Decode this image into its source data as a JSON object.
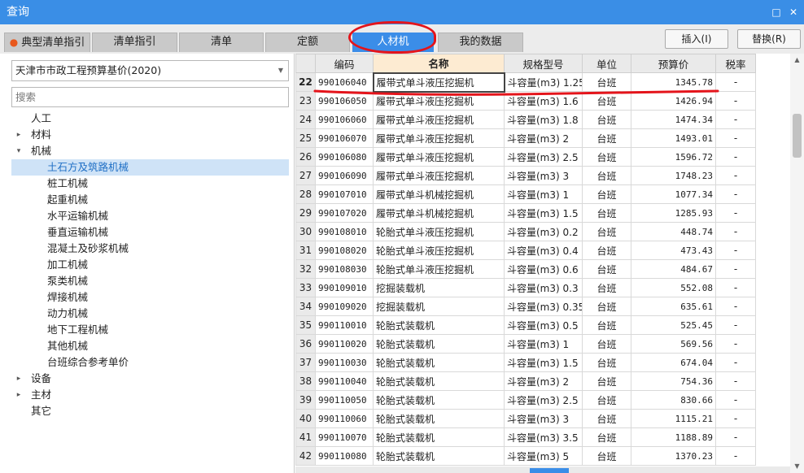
{
  "window": {
    "title": "查询"
  },
  "tabs": [
    {
      "label": "典型清单指引"
    },
    {
      "label": "清单指引"
    },
    {
      "label": "清单"
    },
    {
      "label": "定额"
    },
    {
      "label": "人材机"
    },
    {
      "label": "我的数据"
    }
  ],
  "actions": {
    "insert_label": "插入(I)",
    "replace_label": "替换(R)"
  },
  "left": {
    "library_selected": "天津市市政工程预算基价(2020)",
    "search_placeholder": "搜索",
    "tree": [
      {
        "label": "人工",
        "expander": ""
      },
      {
        "label": "材料",
        "expander": "▸"
      },
      {
        "label": "机械",
        "expander": "▾"
      },
      {
        "label": "土石方及筑路机械",
        "expander": ""
      },
      {
        "label": "桩工机械",
        "expander": ""
      },
      {
        "label": "起重机械",
        "expander": ""
      },
      {
        "label": "水平运输机械",
        "expander": ""
      },
      {
        "label": "垂直运输机械",
        "expander": ""
      },
      {
        "label": "混凝土及砂浆机械",
        "expander": ""
      },
      {
        "label": "加工机械",
        "expander": ""
      },
      {
        "label": "泵类机械",
        "expander": ""
      },
      {
        "label": "焊接机械",
        "expander": ""
      },
      {
        "label": "动力机械",
        "expander": ""
      },
      {
        "label": "地下工程机械",
        "expander": ""
      },
      {
        "label": "其他机械",
        "expander": ""
      },
      {
        "label": "台班综合参考单价",
        "expander": ""
      },
      {
        "label": "设备",
        "expander": "▸"
      },
      {
        "label": "主材",
        "expander": "▸"
      },
      {
        "label": "其它",
        "expander": ""
      }
    ]
  },
  "grid": {
    "headers": {
      "code": "编码",
      "name": "名称",
      "spec": "规格型号",
      "unit": "单位",
      "price": "预算价",
      "tax": "税率"
    },
    "rows": [
      {
        "n": "22",
        "code": "990106040",
        "name": "履带式单斗液压挖掘机",
        "spec": "斗容量(m3) 1.25",
        "unit": "台班",
        "price": "1345.78",
        "tax": "-"
      },
      {
        "n": "23",
        "code": "990106050",
        "name": "履带式单斗液压挖掘机",
        "spec": "斗容量(m3) 1.6",
        "unit": "台班",
        "price": "1426.94",
        "tax": "-"
      },
      {
        "n": "24",
        "code": "990106060",
        "name": "履带式单斗液压挖掘机",
        "spec": "斗容量(m3) 1.8",
        "unit": "台班",
        "price": "1474.34",
        "tax": "-"
      },
      {
        "n": "25",
        "code": "990106070",
        "name": "履带式单斗液压挖掘机",
        "spec": "斗容量(m3) 2",
        "unit": "台班",
        "price": "1493.01",
        "tax": "-"
      },
      {
        "n": "26",
        "code": "990106080",
        "name": "履带式单斗液压挖掘机",
        "spec": "斗容量(m3) 2.5",
        "unit": "台班",
        "price": "1596.72",
        "tax": "-"
      },
      {
        "n": "27",
        "code": "990106090",
        "name": "履带式单斗液压挖掘机",
        "spec": "斗容量(m3) 3",
        "unit": "台班",
        "price": "1748.23",
        "tax": "-"
      },
      {
        "n": "28",
        "code": "990107010",
        "name": "履带式单斗机械挖掘机",
        "spec": "斗容量(m3) 1",
        "unit": "台班",
        "price": "1077.34",
        "tax": "-"
      },
      {
        "n": "29",
        "code": "990107020",
        "name": "履带式单斗机械挖掘机",
        "spec": "斗容量(m3) 1.5",
        "unit": "台班",
        "price": "1285.93",
        "tax": "-"
      },
      {
        "n": "30",
        "code": "990108010",
        "name": "轮胎式单斗液压挖掘机",
        "spec": "斗容量(m3) 0.2",
        "unit": "台班",
        "price": "448.74",
        "tax": "-"
      },
      {
        "n": "31",
        "code": "990108020",
        "name": "轮胎式单斗液压挖掘机",
        "spec": "斗容量(m3) 0.4",
        "unit": "台班",
        "price": "473.43",
        "tax": "-"
      },
      {
        "n": "32",
        "code": "990108030",
        "name": "轮胎式单斗液压挖掘机",
        "spec": "斗容量(m3) 0.6",
        "unit": "台班",
        "price": "484.67",
        "tax": "-"
      },
      {
        "n": "33",
        "code": "990109010",
        "name": "挖掘装载机",
        "spec": "斗容量(m3) 0.3",
        "unit": "台班",
        "price": "552.08",
        "tax": "-"
      },
      {
        "n": "34",
        "code": "990109020",
        "name": "挖掘装载机",
        "spec": "斗容量(m3) 0.35",
        "unit": "台班",
        "price": "635.61",
        "tax": "-"
      },
      {
        "n": "35",
        "code": "990110010",
        "name": "轮胎式装载机",
        "spec": "斗容量(m3) 0.5",
        "unit": "台班",
        "price": "525.45",
        "tax": "-"
      },
      {
        "n": "36",
        "code": "990110020",
        "name": "轮胎式装载机",
        "spec": "斗容量(m3) 1",
        "unit": "台班",
        "price": "569.56",
        "tax": "-"
      },
      {
        "n": "37",
        "code": "990110030",
        "name": "轮胎式装载机",
        "spec": "斗容量(m3) 1.5",
        "unit": "台班",
        "price": "674.04",
        "tax": "-"
      },
      {
        "n": "38",
        "code": "990110040",
        "name": "轮胎式装载机",
        "spec": "斗容量(m3) 2",
        "unit": "台班",
        "price": "754.36",
        "tax": "-"
      },
      {
        "n": "39",
        "code": "990110050",
        "name": "轮胎式装载机",
        "spec": "斗容量(m3) 2.5",
        "unit": "台班",
        "price": "830.66",
        "tax": "-"
      },
      {
        "n": "40",
        "code": "990110060",
        "name": "轮胎式装载机",
        "spec": "斗容量(m3) 3",
        "unit": "台班",
        "price": "1115.21",
        "tax": "-"
      },
      {
        "n": "41",
        "code": "990110070",
        "name": "轮胎式装载机",
        "spec": "斗容量(m3) 3.5",
        "unit": "台班",
        "price": "1188.89",
        "tax": "-"
      },
      {
        "n": "42",
        "code": "990110080",
        "name": "轮胎式装载机",
        "spec": "斗容量(m3) 5",
        "unit": "台班",
        "price": "1370.23",
        "tax": "-"
      }
    ]
  },
  "colors": {
    "titlebar": "#3a8ee6",
    "active_tab": "#3b8de8",
    "annotation_red": "#e4141b",
    "selected_node": "#cfe3f7"
  }
}
